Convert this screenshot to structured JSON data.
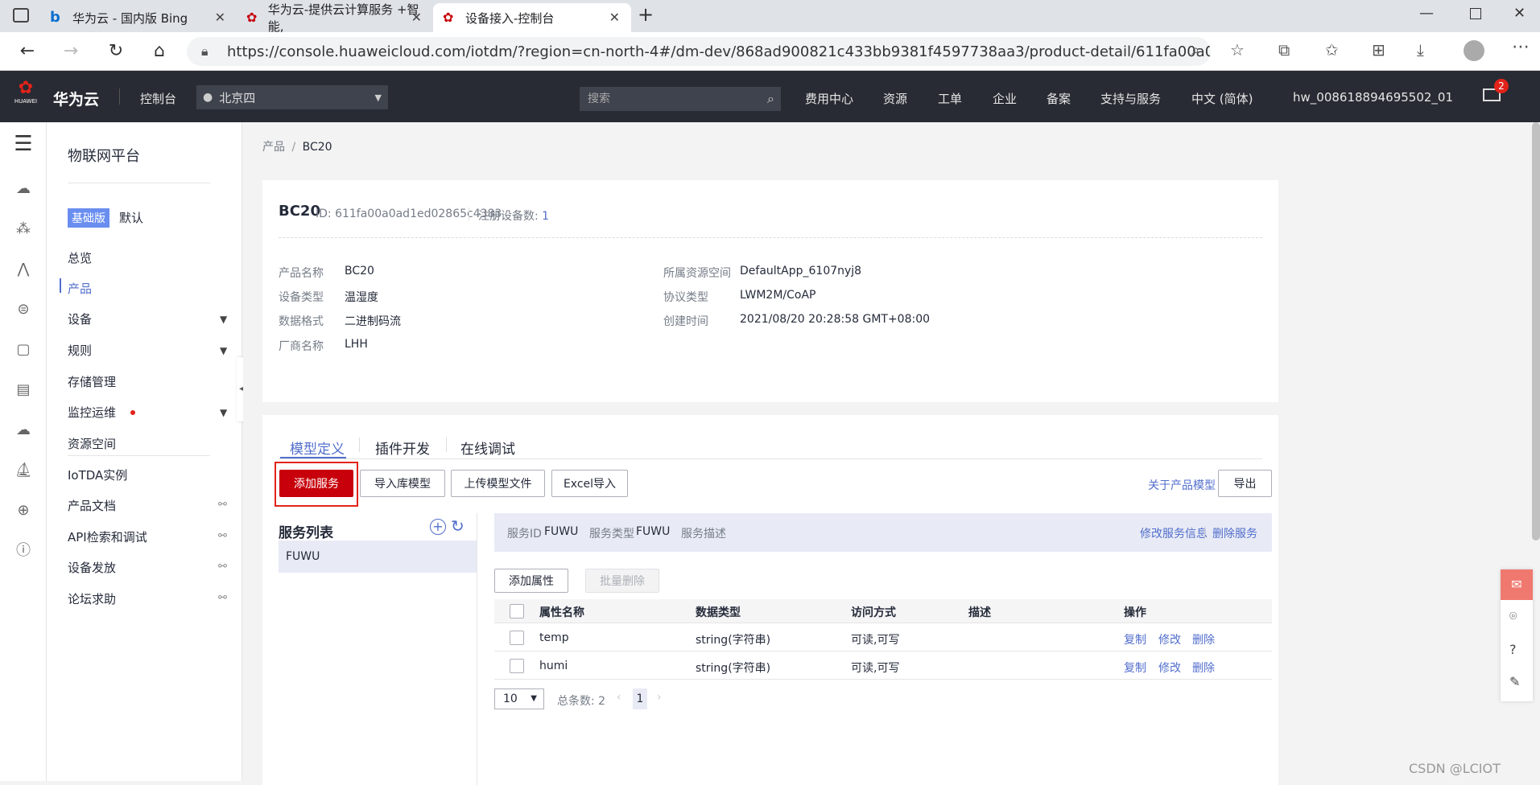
{
  "browser": {
    "tabs": [
      {
        "label": "华为云 - 国内版 Bing"
      },
      {
        "label": "华为云-提供云计算服务 +智能,"
      },
      {
        "label": "设备接入-控制台"
      }
    ],
    "url": "https://console.huaweicloud.com/iotdm/?region=cn-north-4#/dm-dev/868ad900821c433bb9381f4597738aa3/product-detail/611fa00a0ad1ed02865c..."
  },
  "topnav": {
    "brand": "华为云",
    "logo_text": "HUAWEI",
    "console": "控制台",
    "region": "北京四",
    "search_placeholder": "搜索",
    "links": [
      "费用中心",
      "资源",
      "工单",
      "企业",
      "备案",
      "支持与服务",
      "中文 (简体)"
    ],
    "user": "hw_008618894695502_01",
    "mail_badge": "2"
  },
  "sidebar": {
    "title": "物联网平台",
    "edition_badge": "基础版",
    "edition_label": "默认",
    "items": [
      {
        "label": "总览"
      },
      {
        "label": "产品"
      },
      {
        "label": "设备"
      },
      {
        "label": "规则"
      },
      {
        "label": "存储管理"
      },
      {
        "label": "监控运维"
      },
      {
        "label": "资源空间"
      },
      {
        "label": "IoTDA实例"
      },
      {
        "label": "产品文档"
      },
      {
        "label": "API检索和调试"
      },
      {
        "label": "设备发放"
      },
      {
        "label": "论坛求助"
      }
    ]
  },
  "breadcrumb": {
    "parent": "产品",
    "sep": "/",
    "current": "BC20"
  },
  "product": {
    "name": "BC20",
    "id_label": "ID: 611fa00a0ad1ed02865c4383",
    "reg_label": "注册设备数:",
    "reg_value": "1",
    "fields": [
      {
        "label": "产品名称",
        "value": "BC20"
      },
      {
        "label": "设备类型",
        "value": "温湿度"
      },
      {
        "label": "数据格式",
        "value": "二进制码流"
      },
      {
        "label": "厂商名称",
        "value": "LHH"
      },
      {
        "label": "所属资源空间",
        "value": "DefaultApp_6107nyj8"
      },
      {
        "label": "协议类型",
        "value": "LWM2M/CoAP"
      },
      {
        "label": "创建时间",
        "value": "2021/08/20 20:28:58 GMT+08:00"
      }
    ]
  },
  "tabs": [
    {
      "label": "模型定义"
    },
    {
      "label": "插件开发"
    },
    {
      "label": "在线调试"
    }
  ],
  "toolbar": {
    "add_service": "添加服务",
    "import_lib": "导入库模型",
    "upload": "上传模型文件",
    "excel": "Excel导入",
    "about": "关于产品模型",
    "export": "导出"
  },
  "service_list": {
    "title": "服务列表",
    "items": [
      "FUWU"
    ]
  },
  "service_info": {
    "id_label": "服务ID",
    "id_value": "FUWU",
    "type_label": "服务类型",
    "type_value": "FUWU",
    "desc_label": "服务描述",
    "edit": "修改服务信息",
    "delete": "删除服务"
  },
  "props": {
    "add": "添加属性",
    "batch_delete": "批量删除",
    "headers": [
      "属性名称",
      "数据类型",
      "访问方式",
      "描述",
      "操作"
    ],
    "rows": [
      {
        "name": "temp",
        "type": "string(字符串)",
        "access": "可读,可写",
        "desc": ""
      },
      {
        "name": "humi",
        "type": "string(字符串)",
        "access": "可读,可写",
        "desc": ""
      }
    ],
    "actions": [
      "复制",
      "修改",
      "删除"
    ],
    "page_size": "10",
    "total": "总条数: 2",
    "page": "1"
  },
  "watermark": "CSDN @LCIOT"
}
